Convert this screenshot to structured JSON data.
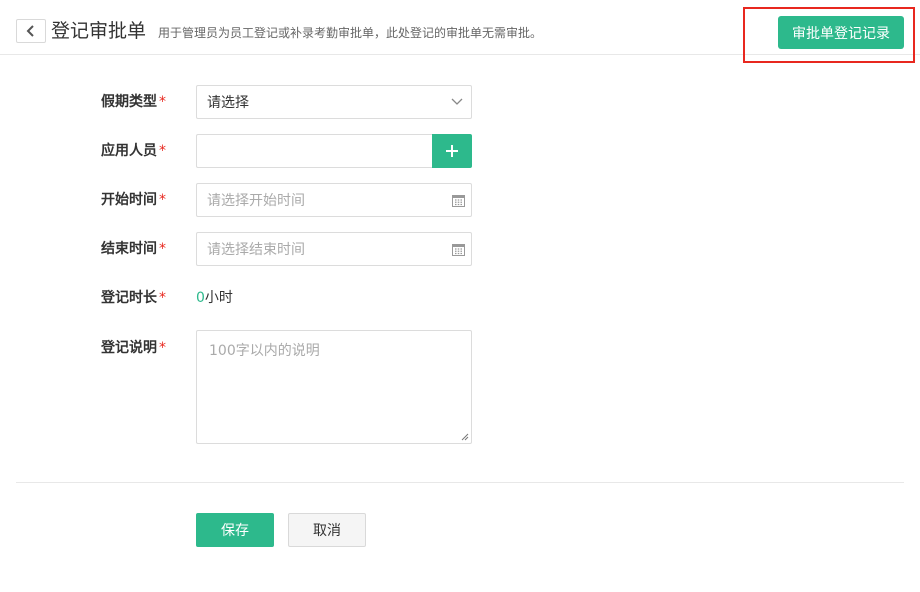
{
  "header": {
    "title": "登记审批单",
    "description": "用于管理员为员工登记或补录考勤审批单，此处登记的审批单无需审批。",
    "records_button": "审批单登记记录"
  },
  "form": {
    "required_mark": "*",
    "leave_type": {
      "label": "假期类型",
      "value": "请选择"
    },
    "applicant": {
      "label": "应用人员",
      "value": ""
    },
    "start_time": {
      "label": "开始时间",
      "placeholder": "请选择开始时间"
    },
    "end_time": {
      "label": "结束时间",
      "placeholder": "请选择结束时间"
    },
    "duration": {
      "label": "登记时长",
      "value": "0",
      "unit": "小时"
    },
    "note": {
      "label": "登记说明",
      "placeholder": "100字以内的说明"
    }
  },
  "actions": {
    "save": "保存",
    "cancel": "取消"
  },
  "colors": {
    "accent": "#2db98c",
    "required": "#e8281f",
    "highlight": "#e8281f"
  },
  "icons": [
    "chevron-left-icon",
    "chevron-down-icon",
    "plus-icon",
    "calendar-icon",
    "resize-grip-icon"
  ]
}
